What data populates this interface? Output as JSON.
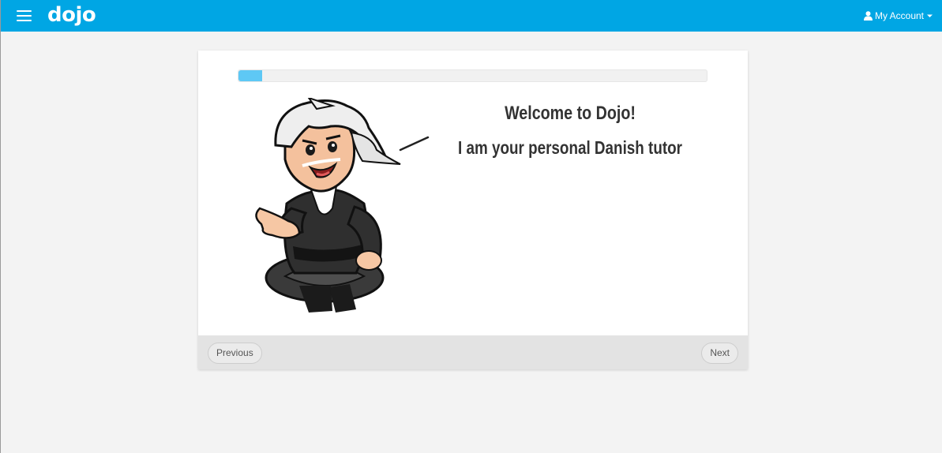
{
  "navbar": {
    "brand": "dojo",
    "menu_icon": "hamburger-menu-icon",
    "account_label": "My Account",
    "account_icon": "user-icon",
    "caret_icon": "caret-down-icon",
    "background_color": "#00a6e4"
  },
  "lesson": {
    "progress": 0.05,
    "progress_color": "#5ec8f5",
    "title": "Welcome to Dojo!",
    "subtitle": "I am your personal Danish tutor",
    "mascot": "sensei-mascot-illustration"
  },
  "footer": {
    "previous_label": "Previous",
    "next_label": "Next"
  }
}
